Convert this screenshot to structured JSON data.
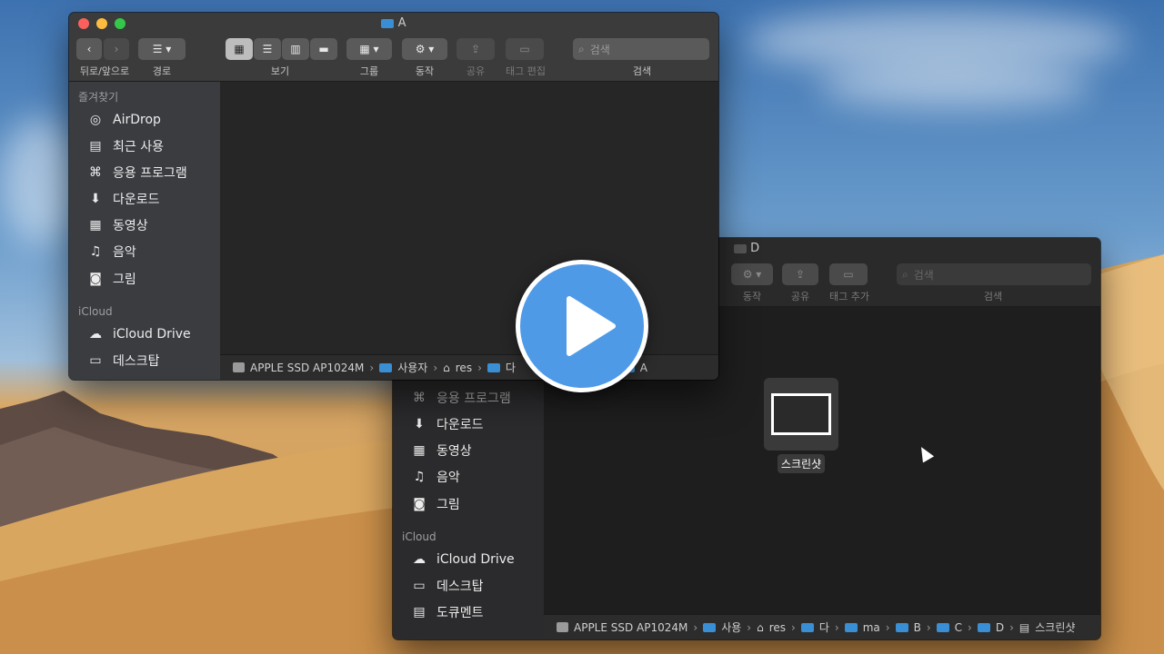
{
  "window_a": {
    "title": "A",
    "nav_label": "뒤로/앞으로",
    "path_label": "경로",
    "view_label": "보기",
    "group_label": "그룹",
    "action_label": "동작",
    "share_label": "공유",
    "tag_label": "태그 편집",
    "search_label": "검색",
    "search_placeholder": "검색",
    "favorites_header": "즐겨찾기",
    "favorites": [
      {
        "label": "AirDrop",
        "icon": "airdrop-icon"
      },
      {
        "label": "최근 사용",
        "icon": "recents-icon"
      },
      {
        "label": "응용 프로그램",
        "icon": "applications-icon"
      },
      {
        "label": "다운로드",
        "icon": "downloads-icon"
      },
      {
        "label": "동영상",
        "icon": "movies-icon"
      },
      {
        "label": "음악",
        "icon": "music-icon"
      },
      {
        "label": "그림",
        "icon": "pictures-icon"
      }
    ],
    "icloud_header": "iCloud",
    "icloud": [
      {
        "label": "iCloud Drive",
        "icon": "cloud-icon"
      },
      {
        "label": "데스크탑",
        "icon": "desktop-icon"
      }
    ],
    "path": [
      "APPLE SSD AP1024M",
      "사용자",
      "res",
      "다",
      "A"
    ]
  },
  "window_d": {
    "title": "D",
    "action_label": "동작",
    "share_label": "공유",
    "tag_label": "태그 추가",
    "search_label": "검색",
    "search_placeholder": "검색",
    "sidebar_items": [
      {
        "label": "응용 프로그램",
        "icon": "applications-icon"
      },
      {
        "label": "다운로드",
        "icon": "downloads-icon"
      },
      {
        "label": "동영상",
        "icon": "movies-icon"
      },
      {
        "label": "음악",
        "icon": "music-icon"
      },
      {
        "label": "그림",
        "icon": "pictures-icon"
      }
    ],
    "icloud_header": "iCloud",
    "icloud": [
      {
        "label": "iCloud Drive",
        "icon": "cloud-icon"
      },
      {
        "label": "데스크탑",
        "icon": "desktop-icon"
      },
      {
        "label": "도큐멘트",
        "icon": "documents-icon"
      }
    ],
    "file": {
      "label": "스크린샷"
    },
    "path": [
      "APPLE SSD AP1024M",
      "사용",
      "res",
      "다",
      "ma",
      "B",
      "C",
      "D",
      "스크린샷"
    ]
  },
  "colors": {
    "folder": "#3a8ed3",
    "play": "#4f9ae7",
    "close": "#fc605c",
    "minimize": "#fdbc40",
    "zoom": "#34c84a"
  }
}
